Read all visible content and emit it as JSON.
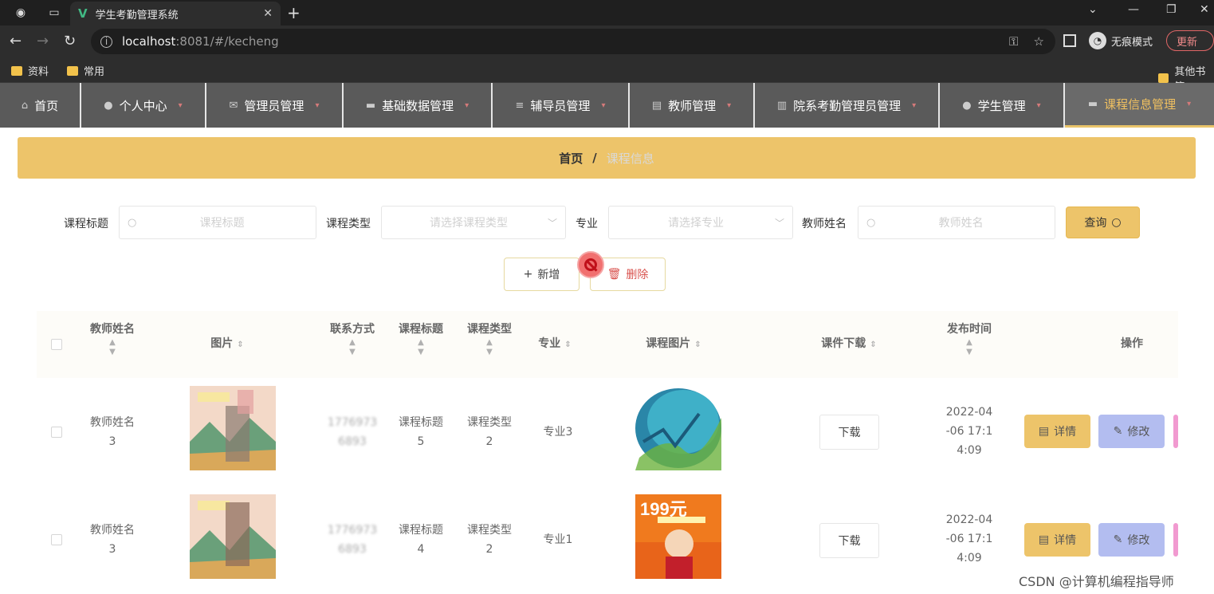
{
  "browser": {
    "tab_title": "学生考勤管理系统",
    "url_host": "localhost",
    "url_path": ":8081/#/kecheng",
    "incognito_label": "无痕模式",
    "update_label": "更新",
    "bookmarks": [
      "资料",
      "常用"
    ],
    "other_bookmarks": "其他书签"
  },
  "nav": {
    "items": [
      {
        "label": "首页",
        "icon": "home-icon"
      },
      {
        "label": "个人中心",
        "icon": "user-icon"
      },
      {
        "label": "管理员管理",
        "icon": "mail-icon"
      },
      {
        "label": "基础数据管理",
        "icon": "chat-icon"
      },
      {
        "label": "辅导员管理",
        "icon": "stack-icon"
      },
      {
        "label": "教师管理",
        "icon": "doc-icon"
      },
      {
        "label": "院系考勤管理员管理",
        "icon": "chart-icon"
      },
      {
        "label": "学生管理",
        "icon": "user-icon"
      },
      {
        "label": "课程信息管理",
        "icon": "folder-icon"
      }
    ]
  },
  "breadcrumb": {
    "home": "首页",
    "separator": "/",
    "current": "课程信息"
  },
  "search": {
    "title_label": "课程标题",
    "title_placeholder": "课程标题",
    "type_label": "课程类型",
    "type_placeholder": "请选择课程类型",
    "major_label": "专业",
    "major_placeholder": "请选择专业",
    "teacher_label": "教师姓名",
    "teacher_placeholder": "教师姓名",
    "query_label": "查询"
  },
  "actions": {
    "add_label": "新增",
    "delete_label": "删除"
  },
  "table": {
    "columns": [
      "教师姓名",
      "图片",
      "联系方式",
      "课程标题",
      "课程类型",
      "专业",
      "课程图片",
      "课件下载",
      "发布时间",
      "操作"
    ],
    "rows": [
      {
        "teacher_name": [
          "教师姓名",
          "3"
        ],
        "phone": [
          "1776973",
          "6893"
        ],
        "course_title": [
          "课程标题",
          "5"
        ],
        "course_type": [
          "课程类型",
          "2"
        ],
        "major": "专业3",
        "download": "下载",
        "publish_time": [
          "2022-04",
          "-06 17:1",
          "4:09"
        ],
        "detail": "详情",
        "edit": "修改"
      },
      {
        "teacher_name": [
          "教师姓名",
          "3"
        ],
        "phone": [
          "1776973",
          "6893"
        ],
        "course_title": [
          "课程标题",
          "4"
        ],
        "course_type": [
          "课程类型",
          "2"
        ],
        "major": "专业1",
        "download": "下载",
        "publish_time": [
          "2022-04",
          "-06 17:1",
          "4:09"
        ],
        "detail": "详情",
        "edit": "修改",
        "promo_text": "199元"
      }
    ]
  },
  "watermark": "CSDN @计算机编程指导师"
}
